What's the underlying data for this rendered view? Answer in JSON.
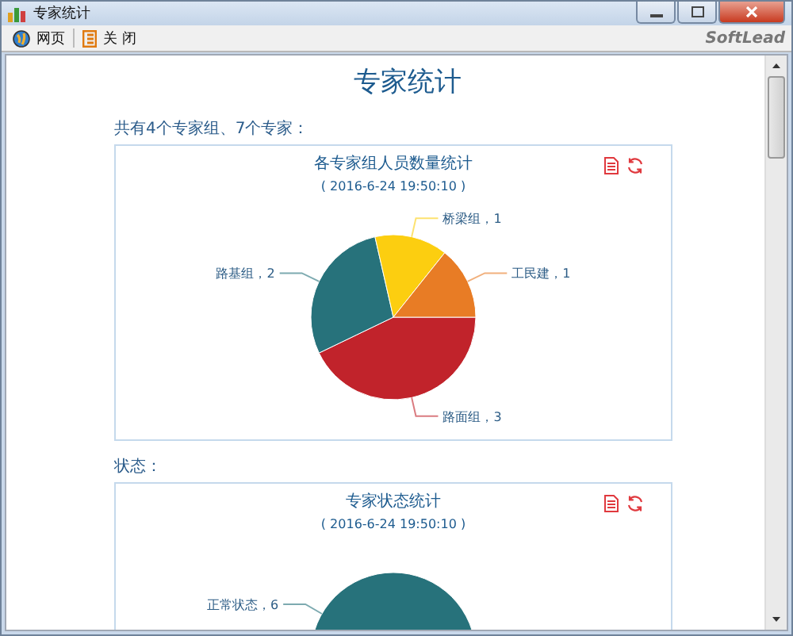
{
  "window": {
    "title": "专家统计"
  },
  "toolbar": {
    "items": [
      {
        "label": "网页",
        "kind": "globe"
      },
      {
        "label": "关 闭",
        "kind": "exit"
      }
    ],
    "brand": "SoftLead"
  },
  "page": {
    "title": "专家统计",
    "sections": [
      {
        "heading": "共有4个专家组、7个专家：",
        "subtitle": "( 2016-6-24 19:50:10 )",
        "label_separator": "，",
        "chart_data": {
          "type": "pie",
          "title": "各专家组人员数量统计",
          "categories": [
            "路面组",
            "路基组",
            "桥梁组",
            "工民建"
          ],
          "colors": [
            "#c1232b",
            "#27727b",
            "#fcce10",
            "#e87c25"
          ],
          "series": [
            {
              "values": [
                3,
                2,
                1,
                1
              ]
            }
          ],
          "data_labels": true
        }
      },
      {
        "heading": "状态：",
        "subtitle": "( 2016-6-24 19:50:10 )",
        "label_separator": "，",
        "chart_data": {
          "type": "pie",
          "title": "专家状态统计",
          "categories": [
            "正常状态"
          ],
          "colors": [
            "#27727b"
          ],
          "series": [
            {
              "values": [
                6
              ]
            }
          ],
          "data_labels": true
        }
      }
    ]
  }
}
